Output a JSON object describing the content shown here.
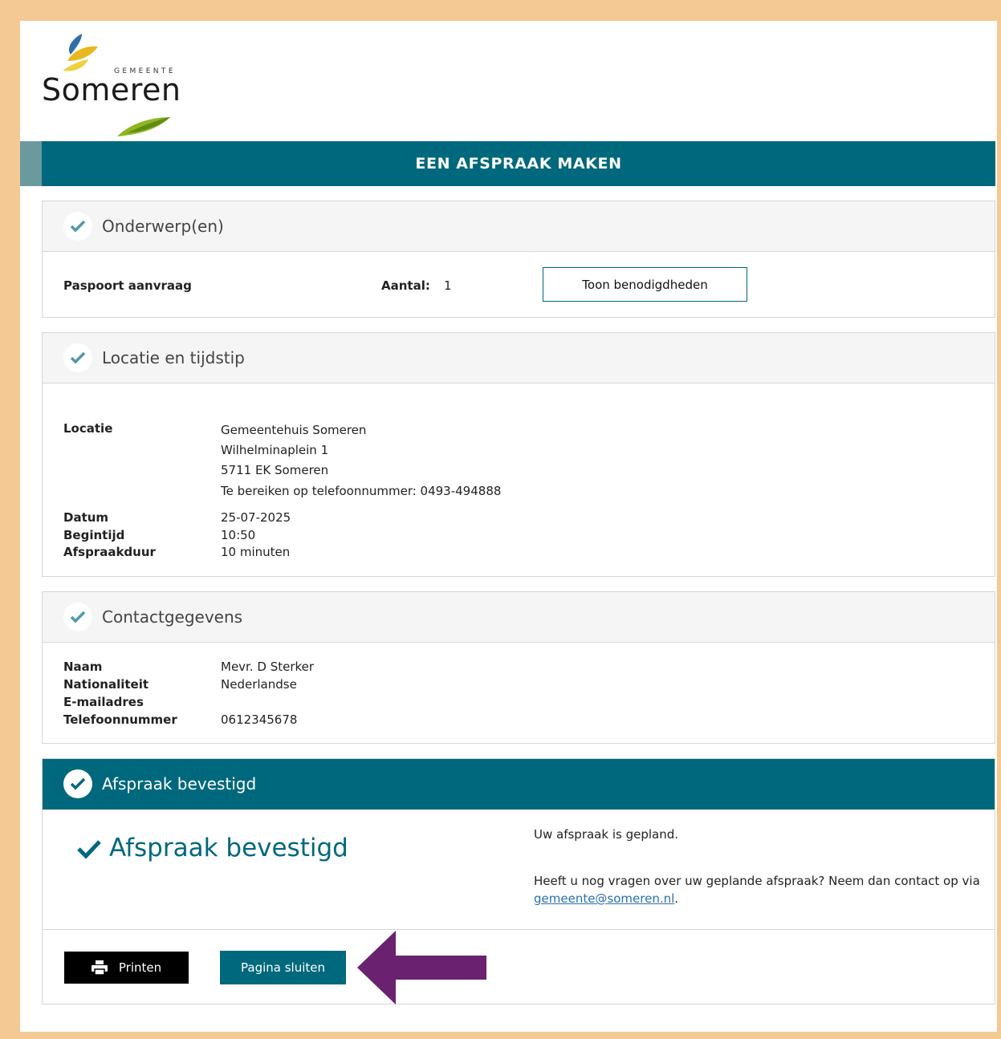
{
  "brand": {
    "logo_small": "GEMEENTE",
    "logo_name": "Someren"
  },
  "page_title": "EEN AFSPRAAK MAKEN",
  "sections": {
    "onderwerp": {
      "heading": "Onderwerp(en)",
      "item_label": "Paspoort aanvraag",
      "count_label": "Aantal:",
      "count_value": "1",
      "button_label": "Toon benodigdheden"
    },
    "locatie": {
      "heading": "Locatie en tijdstip",
      "location_label": "Locatie",
      "address_lines": [
        "Gemeentehuis Someren",
        "Wilhelminaplein 1",
        "5711 EK Someren",
        "Te bereiken op telefoonnummer: 0493-494888"
      ],
      "date_label": "Datum",
      "date_value": "25-07-2025",
      "start_label": "Begintijd",
      "start_value": "10:50",
      "duration_label": "Afspraakduur",
      "duration_value": "10 minuten"
    },
    "contact": {
      "heading": "Contactgegevens",
      "name_label": "Naam",
      "name_value": "Mevr. D Sterker",
      "nationality_label": "Nationaliteit",
      "nationality_value": "Nederlandse",
      "email_label": "E-mailadres",
      "email_value": "",
      "phone_label": "Telefoonnummer",
      "phone_value": "0612345678"
    },
    "confirmed": {
      "heading": "Afspraak bevestigd",
      "big_title": "Afspraak bevestigd",
      "message1": "Uw afspraak is gepland.",
      "message2_prefix": "Heeft u nog vragen over uw geplande afspraak? Neem dan contact op via",
      "message2_link": "gemeente@someren.nl",
      "message2_suffix": "."
    }
  },
  "actions": {
    "print_label": "Printen",
    "close_label": "Pagina sluiten"
  },
  "colors": {
    "primary": "#00687d",
    "frame": "#f5c994",
    "arrow": "#6a2170",
    "check": "#4e9aa8"
  },
  "icons": [
    "check-icon",
    "printer-icon",
    "arrow-left-icon",
    "logo-leaf-icon"
  ]
}
